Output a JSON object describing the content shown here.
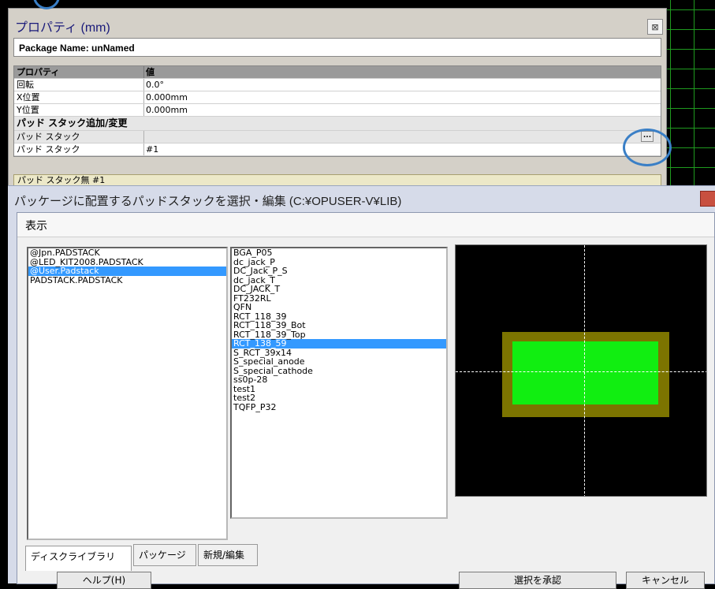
{
  "property_panel": {
    "title": "プロパティ (mm)",
    "close_glyph": "⊠",
    "package_name": "Package Name: unNamed",
    "table_header": {
      "key": "プロパティ",
      "value": "値"
    },
    "rows": [
      {
        "key": "回転",
        "value": "0.0°"
      },
      {
        "key": "X位置",
        "value": "0.000mm"
      },
      {
        "key": "Y位置",
        "value": "0.000mm"
      }
    ],
    "section_label": "パッド スタック追加/変更",
    "pad_rows": [
      {
        "key": "パッド スタック",
        "value": ""
      },
      {
        "key": "パッド スタック",
        "value": "#1"
      }
    ],
    "ellipsis_label": "...",
    "pad_group_label": "パッド スタック無 #1"
  },
  "dialog": {
    "title": "パッケージに配置するパッドスタックを選択・編集 (C:¥OPUSER-V¥LIB)",
    "menu": {
      "display": "表示"
    },
    "libraries": [
      "@Jpn.PADSTACK",
      "@LED_KIT2008.PADSTACK",
      "@User.Padstack",
      "PADSTACK.PADSTACK"
    ],
    "selected_library": "@User.Padstack",
    "padstacks": [
      "BGA_P05",
      "dc_jack_P",
      "DC_Jack_P_S",
      "dc_jack_T",
      "DC_JACK_T",
      "FT232RL",
      "QFN",
      "RCT_118_39",
      "RCT_118_39_Bot",
      "RCT_118_39_Top",
      "RCT_138_59",
      "S_RCT_39x14",
      "S_special_anode",
      "S_special_cathode",
      "ss0p-28",
      "test1",
      "test2",
      "TQFP_P32"
    ],
    "selected_padstack": "RCT_138_59",
    "tabs": [
      "ディスクライブラリ",
      "パッケージ",
      "新規/編集"
    ],
    "buttons": {
      "help": "ヘルプ(H)",
      "confirm": "選択を承認",
      "cancel": "キャンセル"
    },
    "colors": {
      "selection": "#3399ff",
      "pad_fill": "#11ee11",
      "pad_outline": "#7c7400",
      "grid": "#1f9a1f",
      "highlight_circle": "#3a7fc6"
    }
  }
}
